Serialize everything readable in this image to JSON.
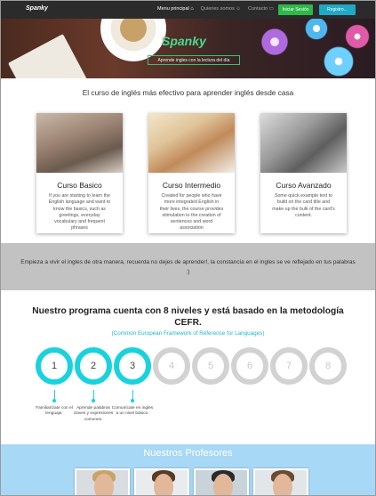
{
  "nav": {
    "brand": "Spanky",
    "menu_principal": "Menu principal",
    "quienes_somos": "Quienes somos",
    "contacto": "Contacto",
    "login": "Iniciar Sesión",
    "register": "Registro..."
  },
  "hero": {
    "title": "Spanky",
    "tagline": "Aprende ingles con la lectura del día"
  },
  "intro": {
    "title": "El curso de inglés más efectivo para aprender inglés desde casa"
  },
  "courses": [
    {
      "title": "Curso Basico",
      "text": "If you are starting to learn the English language and want to know the basics, such as greetings, everyday vocabulary and frequent phrases"
    },
    {
      "title": "Curso Intermedio",
      "text": "Created for people who have more integrated English in their lives, the course provides stimulation to the creation of sentences and word association"
    },
    {
      "title": "Curso Avanzado",
      "text": "Some quick example text to build on the card title and make up the bulk of the card's content."
    }
  ],
  "band": {
    "text": "Empieza a vivir el ingles de otra manera, recuerda no dejes de aprender!, la constancia en el ingles se ve reflejado en tus palabras :)"
  },
  "program": {
    "title": "Nuestro programa cuenta con 8 niveles y está basado en la metodología CEFR.",
    "subtitle": "(Common European Framework of Reference for Languages)",
    "levels": [
      "1",
      "2",
      "3",
      "4",
      "5",
      "6",
      "7",
      "8"
    ],
    "descriptions": [
      "Familiarízate con el lenguaje.",
      "Aprende palabras claves y expresiones comunes.",
      "Comunícate en inglés a un nivel básico."
    ]
  },
  "teachers": {
    "title": "Nuestros Profesores"
  },
  "colors": {
    "nav_bg": "#2b2b2b",
    "login_green": "#2fb84a",
    "register_blue": "#1fa9c5",
    "level_active": "#19d2dd",
    "level_inactive": "#d2d2d2",
    "teachers_bg": "#a7d8f5"
  }
}
